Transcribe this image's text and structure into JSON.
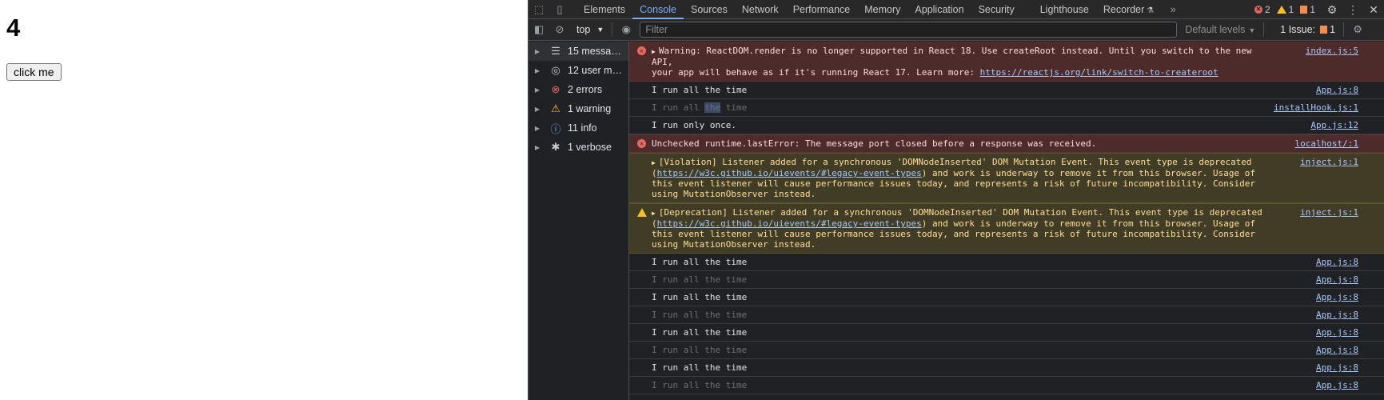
{
  "page": {
    "counter_value": "4",
    "button_label": "click me"
  },
  "devtools": {
    "tabs": [
      {
        "label": "Elements",
        "active": false
      },
      {
        "label": "Console",
        "active": true
      },
      {
        "label": "Sources",
        "active": false
      },
      {
        "label": "Network",
        "active": false
      },
      {
        "label": "Performance",
        "active": false
      },
      {
        "label": "Memory",
        "active": false
      },
      {
        "label": "Application",
        "active": false
      },
      {
        "label": "Security",
        "active": false
      },
      {
        "label": "Lighthouse",
        "active": false
      },
      {
        "label": "Recorder",
        "active": false
      }
    ],
    "badges": {
      "errors": "2",
      "warnings": "1",
      "issues": "1"
    },
    "toolbar": {
      "context": "top",
      "filter_placeholder": "Filter",
      "levels": "Default levels",
      "issues_label": "1 Issue:",
      "issues_count": "1"
    },
    "sidebar": [
      {
        "label": "15 messa…",
        "icon": "list-icon",
        "selected": true
      },
      {
        "label": "12 user m…",
        "icon": "user-icon",
        "selected": false
      },
      {
        "label": "2 errors",
        "icon": "error-icon",
        "selected": false
      },
      {
        "label": "1 warning",
        "icon": "warning-icon",
        "selected": false
      },
      {
        "label": "11 info",
        "icon": "info-icon",
        "selected": false
      },
      {
        "label": "1 verbose",
        "icon": "bug-icon",
        "selected": false
      }
    ],
    "messages": [
      {
        "type": "error",
        "text_a": "Warning: ReactDOM.render is no longer supported in React 18. Use createRoot instead. Until you switch to the new API,\nyour app will behave as if it's running React 17. Learn more: ",
        "link": "https://reactjs.org/link/switch-to-createroot",
        "source": "index.js:5"
      },
      {
        "type": "log",
        "text": "I run all the time",
        "source": "App.js:8"
      },
      {
        "type": "dim",
        "text_a": "I run all ",
        "text_hl": "the",
        "text_b": " time",
        "source": "installHook.js:1"
      },
      {
        "type": "log",
        "text": "I run only once.",
        "source": "App.js:12"
      },
      {
        "type": "error2",
        "text": "Unchecked runtime.lastError: The message port closed before a response was received.",
        "source": "localhost/:1"
      },
      {
        "type": "violation",
        "text_a": "[Violation] Listener added for a synchronous 'DOMNodeInserted' DOM Mutation Event. This event type is deprecated (",
        "link": "https://w3c.github.io/uievents/#legacy-event-types",
        "text_b": ") and work is underway to remove it from this browser. Usage of this event listener will cause performance issues today, and represents a risk of future incompatibility. Consider using MutationObserver instead.",
        "source": "inject.js:1"
      },
      {
        "type": "warning",
        "text_a": "[Deprecation] Listener added for a synchronous 'DOMNodeInserted' DOM Mutation Event. This event type is deprecated (",
        "link": "https://w3c.github.io/uievents/#legacy-event-types",
        "text_b": ") and work is underway to remove it from this browser. Usage of this event listener will cause performance issues today, and represents a risk of future incompatibility. Consider using MutationObserver instead.",
        "source": "inject.js:1"
      },
      {
        "type": "log",
        "text": "I run all the time",
        "source": "App.js:8"
      },
      {
        "type": "dim",
        "text": "I run all the time",
        "source": "App.js:8"
      },
      {
        "type": "log",
        "text": "I run all the time",
        "source": "App.js:8"
      },
      {
        "type": "dim",
        "text": "I run all the time",
        "source": "App.js:8"
      },
      {
        "type": "log",
        "text": "I run all the time",
        "source": "App.js:8"
      },
      {
        "type": "dim",
        "text": "I run all the time",
        "source": "App.js:8"
      },
      {
        "type": "log",
        "text": "I run all the time",
        "source": "App.js:8"
      },
      {
        "type": "dim",
        "text": "I run all the time",
        "source": "App.js:8"
      }
    ],
    "prompt": "›"
  }
}
